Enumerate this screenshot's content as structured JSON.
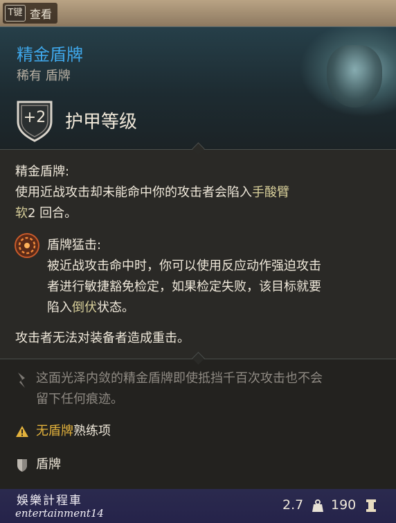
{
  "keybind": {
    "key": "T键",
    "action": "查看"
  },
  "item": {
    "name": "精金盾牌",
    "rarity_type": "稀有 盾牌",
    "armor_bonus": "+2",
    "armor_label": "护甲等级"
  },
  "effects": {
    "passive_title": "精金盾牌:",
    "passive_line1": "使用近战攻击却未能命中你的攻击者会陷入",
    "passive_hl1": "手酸臂",
    "passive_hl2": "软",
    "passive_line2_rest": "2 回合。",
    "reaction_title": "盾牌猛击:",
    "reaction_line1": "被近战攻击命中时，你可以使用反应动作强迫攻击",
    "reaction_line2": "者进行敏捷豁免检定，如果检定失败，该目标就要",
    "reaction_line3_pre": "陷入",
    "reaction_line3_hl": "倒伏",
    "reaction_line3_post": "状态。",
    "crit_immunity": "攻击者无法对装备者造成重击。"
  },
  "flavor": {
    "line1": "这面光泽内敛的精金盾牌即使抵挡千百次攻击也不会",
    "line2": "留下任何痕迹。"
  },
  "proficiency_warning": {
    "hl": "无盾牌",
    "rest": "熟练项"
  },
  "category": "盾牌",
  "footer": {
    "watermark_line1": "娛樂計程車",
    "watermark_line2": "entertainment14",
    "weight": "2.7",
    "value": "190"
  },
  "colors": {
    "item_name": "#3fa7ea",
    "highlight": "#d8cf9a",
    "warning": "#e3b23c",
    "footer_bg": "#2b2a4e"
  }
}
